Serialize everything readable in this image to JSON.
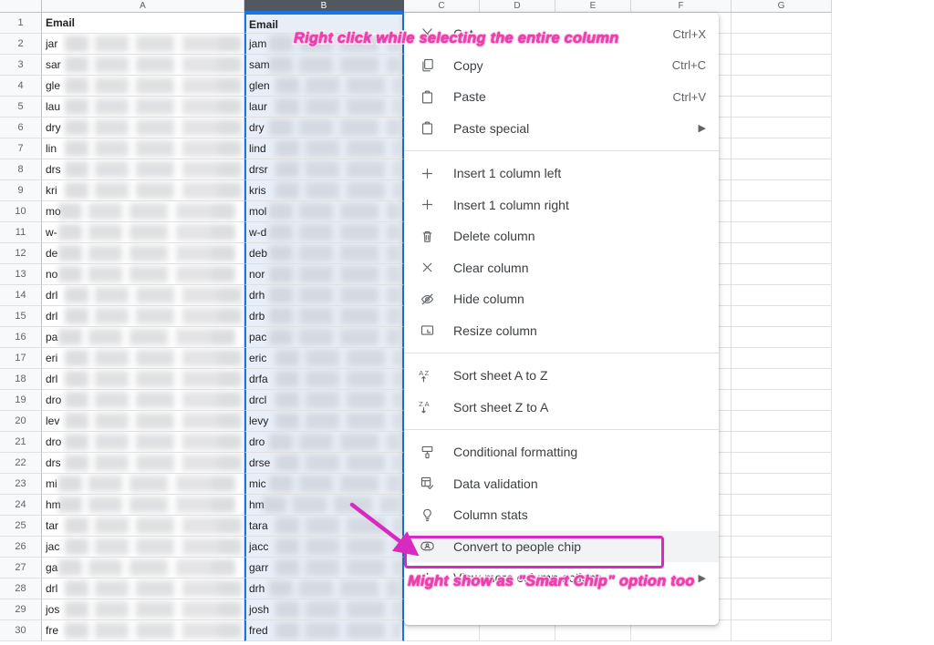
{
  "app": {
    "name": "google-sheets"
  },
  "spreadsheet": {
    "column_headers": [
      "A",
      "B",
      "C",
      "D",
      "E",
      "F",
      "G"
    ],
    "selected_column": "B",
    "header_row_labels": {
      "A": "Email",
      "B": "Email"
    },
    "row_numbers": [
      1,
      2,
      3,
      4,
      5,
      6,
      7,
      8,
      9,
      10,
      11,
      12,
      13,
      14,
      15,
      16,
      17,
      18,
      19,
      20,
      21,
      22,
      23,
      24,
      25,
      26,
      27,
      28,
      29,
      30
    ],
    "column_a_values": [
      "Email",
      "jar",
      "sar",
      "gle",
      "lau",
      "dry",
      "lin",
      "drs",
      "kri",
      "mo",
      "w-",
      "de",
      "no",
      "drl",
      "drl",
      "pa",
      "eri",
      "drl",
      "dro",
      "lev",
      "dro",
      "drs",
      "mi",
      "hm",
      "tar",
      "jac",
      "ga",
      "drl",
      "jos",
      "fre"
    ],
    "column_b_values": [
      "Email",
      "jam",
      "sam",
      "glen",
      "laur",
      "dry",
      "lind",
      "drsr",
      "kris",
      "mol",
      "w-d",
      "deb",
      "nor",
      "drh",
      "drb",
      "pac",
      "eric",
      "drfa",
      "drcl",
      "levy",
      "dro",
      "drse",
      "mic",
      "hm",
      "tara",
      "jacc",
      "garr",
      "drh",
      "josh",
      "fred"
    ]
  },
  "context_menu": {
    "groups": [
      {
        "items": [
          {
            "icon": "cut-icon",
            "label": "Cut",
            "accel": "Ctrl+X",
            "submenu": false
          },
          {
            "icon": "copy-icon",
            "label": "Copy",
            "accel": "Ctrl+C",
            "submenu": false
          },
          {
            "icon": "paste-icon",
            "label": "Paste",
            "accel": "Ctrl+V",
            "submenu": false
          },
          {
            "icon": "paste-special-icon",
            "label": "Paste special",
            "accel": "",
            "submenu": true
          }
        ]
      },
      {
        "items": [
          {
            "icon": "plus-icon",
            "label": "Insert 1 column left",
            "accel": "",
            "submenu": false
          },
          {
            "icon": "plus-icon",
            "label": "Insert 1 column right",
            "accel": "",
            "submenu": false
          },
          {
            "icon": "trash-icon",
            "label": "Delete column",
            "accel": "",
            "submenu": false
          },
          {
            "icon": "close-x-icon",
            "label": "Clear column",
            "accel": "",
            "submenu": false
          },
          {
            "icon": "eye-off-icon",
            "label": "Hide column",
            "accel": "",
            "submenu": false
          },
          {
            "icon": "resize-icon",
            "label": "Resize column",
            "accel": "",
            "submenu": false
          }
        ]
      },
      {
        "items": [
          {
            "icon": "sort-az-icon",
            "label": "Sort sheet A to Z",
            "accel": "",
            "submenu": false
          },
          {
            "icon": "sort-za-icon",
            "label": "Sort sheet Z to A",
            "accel": "",
            "submenu": false
          }
        ]
      },
      {
        "items": [
          {
            "icon": "conditional-formatting-icon",
            "label": "Conditional formatting",
            "accel": "",
            "submenu": false
          },
          {
            "icon": "data-validation-icon",
            "label": "Data validation",
            "accel": "",
            "submenu": false
          },
          {
            "icon": "lightbulb-icon",
            "label": "Column stats",
            "accel": "",
            "submenu": false
          },
          {
            "icon": "people-chip-icon",
            "label": "Convert to people chip",
            "accel": "",
            "submenu": false,
            "highlighted": true
          },
          {
            "icon": "more-vert-icon",
            "label": "View more column actions",
            "accel": "",
            "submenu": true
          }
        ]
      }
    ]
  },
  "annotations": {
    "top_note": "Right click while selecting the entire column",
    "bottom_note": "Might show as \"Smart Chip\" option too",
    "highlight_color": "#d62ac0",
    "text_color": "#ee3fae",
    "arrow_color": "#d62ac0"
  }
}
